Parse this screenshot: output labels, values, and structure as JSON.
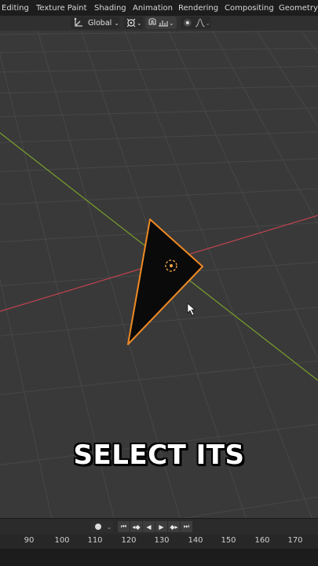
{
  "workspace_tabs": [
    "Editing",
    "Texture Paint",
    "Shading",
    "Animation",
    "Rendering",
    "Compositing",
    "Geometry N"
  ],
  "toolbar": {
    "transform_orientation": "Global"
  },
  "caption": "SELECT ITS",
  "timeline": {
    "frame_labels": [
      "90",
      "100",
      "110",
      "120",
      "130",
      "140",
      "150",
      "160",
      "170"
    ]
  },
  "colors": {
    "selection_outline": "#f08a24",
    "x_axis": "#c0434f",
    "y_axis": "#7aa02b",
    "viewport_bg": "#393939"
  },
  "icons": {
    "toolbar": [
      "transform-pivot-icon",
      "snap-icon",
      "proportional-editing-icon",
      "falloff-curve-icon"
    ],
    "playback": [
      "record-icon",
      "jump-start-icon",
      "prev-keyframe-icon",
      "play-reverse-icon",
      "play-icon",
      "next-keyframe-icon",
      "jump-end-icon"
    ]
  }
}
